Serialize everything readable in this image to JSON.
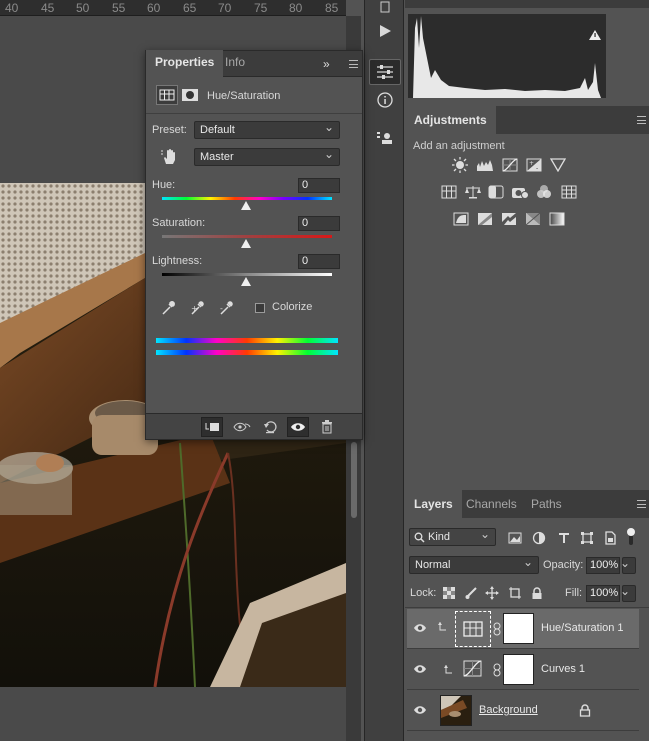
{
  "ruler": {
    "ticks": [
      "40",
      "45",
      "50",
      "55",
      "60",
      "65",
      "70",
      "75",
      "80",
      "85"
    ]
  },
  "properties": {
    "tabs": [
      "Properties",
      "Info"
    ],
    "header_title": "Hue/Saturation",
    "preset_label": "Preset:",
    "preset_value": "Default",
    "channel_value": "Master",
    "hue_label": "Hue:",
    "hue_value": "0",
    "saturation_label": "Saturation:",
    "saturation_value": "0",
    "lightness_label": "Lightness:",
    "lightness_value": "0",
    "colorize_label": "Colorize",
    "colorize_checked": false
  },
  "adjustments": {
    "tab": "Adjustments",
    "subtitle": "Add an adjustment",
    "row1": [
      "brightness-contrast-icon",
      "levels-icon",
      "curves-icon",
      "exposure-icon",
      "vibrance-icon"
    ],
    "row2": [
      "hue-saturation-icon",
      "color-balance-icon",
      "black-white-icon",
      "photo-filter-icon",
      "channel-mixer-icon",
      "color-lookup-icon"
    ],
    "row3": [
      "invert-icon",
      "posterize-icon",
      "threshold-icon",
      "selective-color-icon",
      "gradient-map-icon"
    ]
  },
  "layers": {
    "tabs": [
      "Layers",
      "Channels",
      "Paths"
    ],
    "filter_kind": "Kind",
    "blend_mode": "Normal",
    "opacity_label": "Opacity:",
    "opacity_value": "100%",
    "lock_label": "Lock:",
    "fill_label": "Fill:",
    "fill_value": "100%",
    "items": [
      {
        "name": "Hue/Saturation 1",
        "selected": true
      },
      {
        "name": "Curves 1",
        "selected": false
      },
      {
        "name": "Background",
        "selected": false
      }
    ]
  },
  "colors": {
    "accent": "#2a2a2a",
    "panel": "#535353",
    "selected_row": "#6a6a6a"
  }
}
